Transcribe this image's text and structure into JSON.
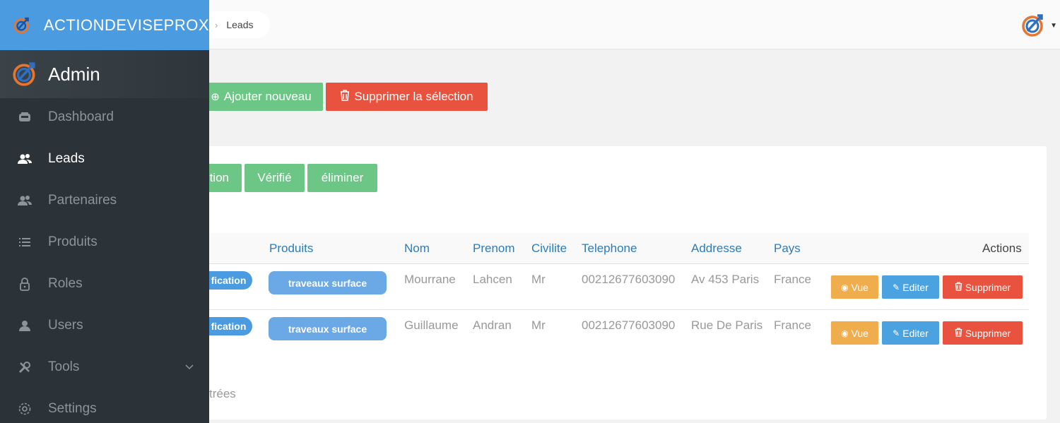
{
  "brand": {
    "name": "ACTIONDEVISEPROX"
  },
  "admin": {
    "name": "Admin"
  },
  "sidebar": {
    "items": [
      {
        "label": "Dashboard",
        "icon": "dashboard-icon",
        "active": false
      },
      {
        "label": "Leads",
        "icon": "users-icon",
        "active": true
      },
      {
        "label": "Partenaires",
        "icon": "users-icon",
        "active": false
      },
      {
        "label": "Produits",
        "icon": "list-icon",
        "active": false
      },
      {
        "label": "Roles",
        "icon": "lock-icon",
        "active": false
      },
      {
        "label": "Users",
        "icon": "user-icon",
        "active": false
      },
      {
        "label": "Tools",
        "icon": "tools-icon",
        "active": false
      },
      {
        "label": "Settings",
        "icon": "gear-icon",
        "active": false
      }
    ]
  },
  "breadcrumb": {
    "current": "Leads"
  },
  "toolbar": {
    "add_label": "Ajouter nouveau",
    "delete_selection_label": "Supprimer la sélection"
  },
  "filters": {
    "partial_label": "tion",
    "verified_label": "Vérifié",
    "eliminate_label": "éliminer"
  },
  "table": {
    "columns": [
      "Produits",
      "Nom",
      "Prenom",
      "Civilite",
      "Telephone",
      "Addresse",
      "Pays",
      "Actions"
    ],
    "rows": [
      {
        "status": "fication",
        "produit": "traveaux surface",
        "nom": "Mourrane",
        "prenom": "Lahcen",
        "civilite": "Mr",
        "telephone": "00212677603090",
        "addresse": "Av 453 Paris",
        "pays": "France"
      },
      {
        "status": "fication",
        "produit": "traveaux surface",
        "nom": "Guillaume",
        "prenom": "Andran",
        "civilite": "Mr",
        "telephone": "00212677603090",
        "addresse": "Rue De Paris",
        "pays": "France"
      }
    ],
    "actions": {
      "view": "Vue",
      "edit": "Editer",
      "delete": "Supprimer"
    },
    "footer_partial": "trées"
  },
  "colors": {
    "brand": "#4a9be0",
    "sidebar": "#2b3338",
    "success": "#6cc685",
    "danger": "#e9523e",
    "warning": "#f0ad4e"
  }
}
